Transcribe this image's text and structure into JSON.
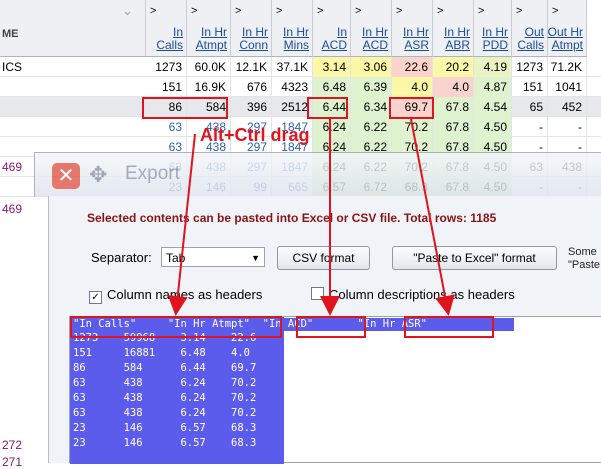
{
  "grid": {
    "first_header": "ME",
    "headers": [
      {
        "arrow": ">",
        "label": "In\nCalls"
      },
      {
        "arrow": ">",
        "label": "In Hr\nAtmpt"
      },
      {
        "arrow": ">",
        "label": "In Hr\nConn"
      },
      {
        "arrow": ">",
        "label": "In Hr\nMins"
      },
      {
        "arrow": ">",
        "label": "In\nACD"
      },
      {
        "arrow": ">",
        "label": "In Hr\nACD"
      },
      {
        "arrow": ">",
        "label": "In Hr\nASR"
      },
      {
        "arrow": ">",
        "label": "In Hr\nABR"
      },
      {
        "arrow": ">",
        "label": "In Hr\nPDD"
      },
      {
        "arrow": ">",
        "label": "Out\nCalls"
      },
      {
        "arrow": ">",
        "label": "Out Hr\nAtmpt"
      }
    ],
    "rows": [
      {
        "left": "ICS",
        "cells": [
          "1273",
          "60.0K",
          "12.1K",
          "37.1K",
          "3.14",
          "3.06",
          "22.6",
          "20.2",
          "4.19",
          "1273",
          "71.2K"
        ]
      },
      {
        "left": "",
        "cells": [
          "151",
          "16.9K",
          "676",
          "4323",
          "6.48",
          "6.39",
          "4.0",
          "4.0",
          "4.87",
          "151",
          "1041"
        ]
      },
      {
        "left": "",
        "cells": [
          "86",
          "584",
          "396",
          "2512",
          "6.44",
          "6.34",
          "69.7",
          "67.8",
          "4.54",
          "65",
          "452"
        ]
      },
      {
        "left": "",
        "cells": [
          "63",
          "438",
          "297",
          "1847",
          "6.24",
          "6.22",
          "70.2",
          "67.8",
          "4.50",
          "-",
          "-"
        ]
      },
      {
        "left": "",
        "cells": [
          "63",
          "438",
          "297",
          "1847",
          "6.24",
          "6.22",
          "70.2",
          "67.8",
          "4.50",
          "-",
          "-"
        ]
      },
      {
        "left": "469",
        "cells": [
          "63",
          "438",
          "297",
          "1847",
          "6.24",
          "6.22",
          "70.2",
          "67.8",
          "4.50",
          "63",
          "438"
        ]
      },
      {
        "left": "",
        "cells": [
          "23",
          "146",
          "99",
          "665",
          "6.57",
          "6.72",
          "68.3",
          "67.8",
          "4.50",
          "-",
          "-"
        ]
      }
    ],
    "left_extra": [
      "469",
      "272",
      "271"
    ]
  },
  "annotation": "Alt+Ctrl drag",
  "dialog": {
    "title": "Export",
    "close_glyph": "✕",
    "move_glyph": "✥",
    "info": "Selected contents can be pasted into Excel or CSV file. Total rows: 1185",
    "separator_label": "Separator:",
    "separator_value": "Tab",
    "csv_button": "CSV format",
    "paste_button": "\"Paste to Excel\" format",
    "side_note": "Some\n\"Paste",
    "checkbox_names": "Column names as headers",
    "checkbox_names_checked": true,
    "checkbox_desc": "Column descriptions as headers",
    "checkbox_desc_checked": false,
    "text_header": "\"In Calls\"     \"In Hr Atmpt\"  \"In ACD\"       \"In Hr ASR\"",
    "text_lines": [
      "1273    59968    3.14    22.6",
      "151     16881    6.48    4.0",
      "86      584      6.44    69.7",
      "63      438      6.24    70.2",
      "63      438      6.24    70.2",
      "63      438      6.24    70.2",
      "23      146      6.57    68.3",
      "23      146      6.57    68.3"
    ]
  },
  "colors": {
    "accent_red": "#e0141e",
    "selection": "#5c5cec",
    "title_red": "#8a1414"
  }
}
